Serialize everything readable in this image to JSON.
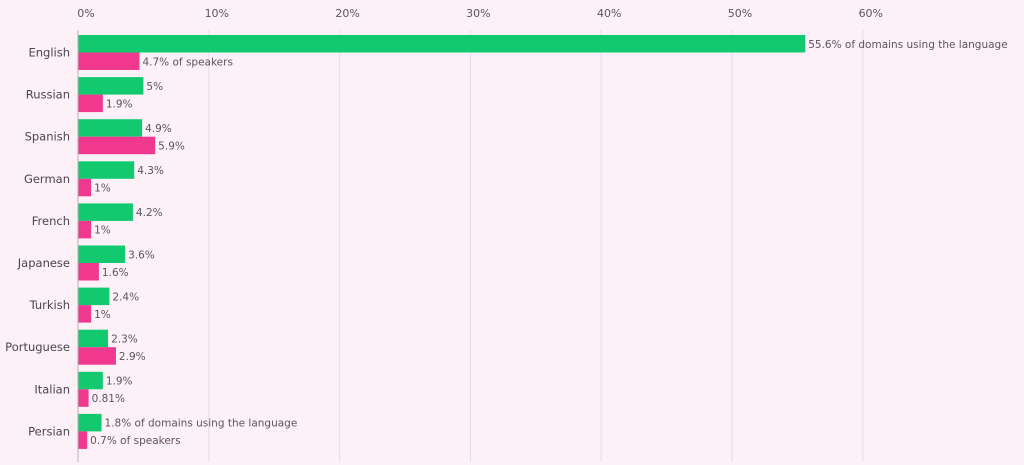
{
  "chart_data": {
    "type": "bar",
    "orientation": "horizontal",
    "xlim": [
      0,
      70
    ],
    "x_ticks": [
      0,
      10,
      20,
      30,
      40,
      50,
      60
    ],
    "x_tick_labels": [
      "0%",
      "10%",
      "20%",
      "30%",
      "40%",
      "50%",
      "60%"
    ],
    "grid": true,
    "categories": [
      "English",
      "Russian",
      "Spanish",
      "German",
      "French",
      "Japanese",
      "Turkish",
      "Portuguese",
      "Italian",
      "Persian"
    ],
    "series": [
      {
        "color": "#12c96f",
        "values": [
          55.6,
          5,
          4.9,
          4.3,
          4.2,
          3.6,
          2.4,
          2.3,
          1.9,
          1.8
        ],
        "labels": [
          "55.6% of domains using the language",
          "5%",
          "4.9%",
          "4.3%",
          "4.2%",
          "3.6%",
          "2.4%",
          "2.3%",
          "1.9%",
          "1.8% of domains using the language"
        ]
      },
      {
        "color": "#f0388f",
        "values": [
          4.7,
          1.9,
          5.9,
          1,
          1,
          1.6,
          1,
          2.9,
          0.81,
          0.7
        ],
        "labels": [
          "4.7% of speakers",
          "1.9%",
          "5.9%",
          "1%",
          "1%",
          "1.6%",
          "1%",
          "2.9%",
          "0.81%",
          "0.7% of speakers"
        ]
      }
    ]
  }
}
